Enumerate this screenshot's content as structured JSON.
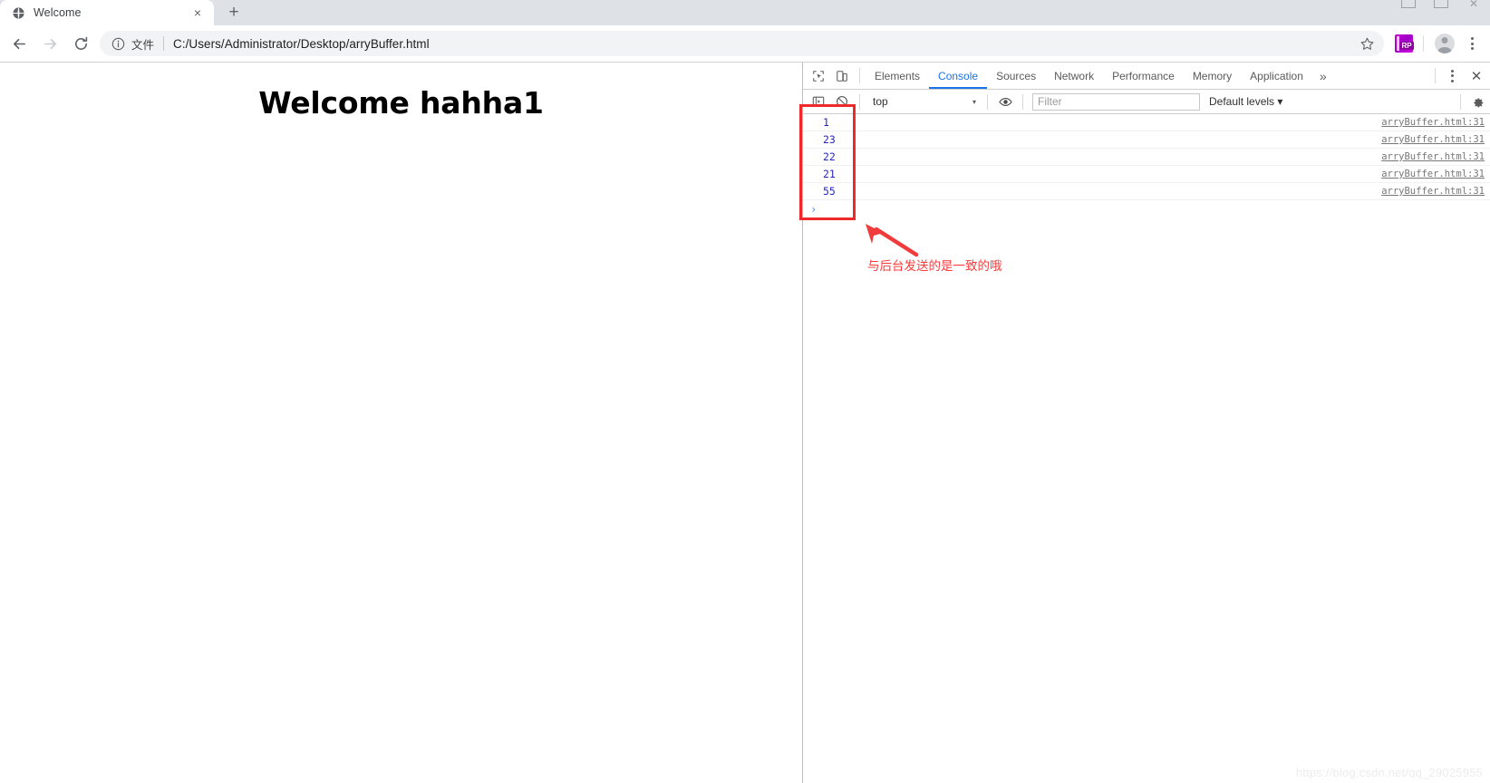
{
  "window": {
    "controls": [
      "minimize",
      "maximize",
      "close"
    ]
  },
  "tabstrip": {
    "tab": {
      "title": "Welcome",
      "favicon": "globe-icon",
      "close": "×"
    },
    "new_tab_label": "+"
  },
  "toolbar": {
    "back": "←",
    "forward": "→",
    "reload": "↻",
    "omnibox": {
      "info_icon": "info-circle-icon",
      "scheme_label": "文件",
      "url": "C:/Users/Administrator/Desktop/arryBuffer.html",
      "star_icon": "star-icon"
    },
    "extension": {
      "name": "RP",
      "label": "RP"
    },
    "avatar": "profile-avatar",
    "menu": "kebab-menu"
  },
  "page": {
    "heading": "Welcome hahha1"
  },
  "devtools": {
    "tools": {
      "inspect": "inspect-element-icon",
      "device": "device-toolbar-icon"
    },
    "tabs": [
      {
        "label": "Elements",
        "active": false
      },
      {
        "label": "Console",
        "active": true
      },
      {
        "label": "Sources",
        "active": false
      },
      {
        "label": "Network",
        "active": false
      },
      {
        "label": "Performance",
        "active": false
      },
      {
        "label": "Memory",
        "active": false
      },
      {
        "label": "Application",
        "active": false
      }
    ],
    "more_tabs": "»",
    "settings_menu": "⋮",
    "close": "✕",
    "filterbar": {
      "execute_icon": "execute-snippet-icon",
      "clear_icon": "clear-console-icon",
      "context": "top",
      "context_caret": "▾",
      "eye_icon": "live-expression-icon",
      "filter_placeholder": "Filter",
      "filter_value": "",
      "levels": "Default levels",
      "levels_caret": "▾",
      "gear_icon": "settings-gear-icon"
    },
    "console": {
      "logs": [
        {
          "value": "1",
          "source": "arryBuffer.html:31"
        },
        {
          "value": "23",
          "source": "arryBuffer.html:31"
        },
        {
          "value": "22",
          "source": "arryBuffer.html:31"
        },
        {
          "value": "21",
          "source": "arryBuffer.html:31"
        },
        {
          "value": "55",
          "source": "arryBuffer.html:31"
        }
      ],
      "prompt_caret": "›"
    }
  },
  "annotation": {
    "text": "与后台发送的是一致的哦",
    "color": "#fb3b3b",
    "box_color": "#ef2929"
  },
  "watermark": {
    "text": "https://blog.csdn.net/qq_29025955"
  }
}
